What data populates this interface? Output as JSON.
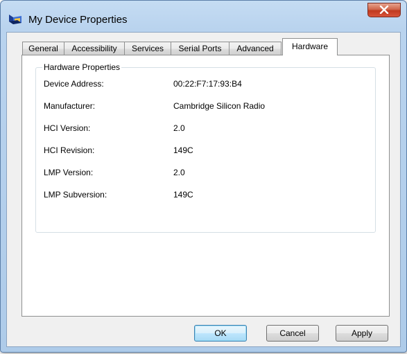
{
  "window": {
    "title": "My Device Properties",
    "app_icon": "bluetooth-device-icon",
    "close_icon": "close-icon",
    "accent_close": "#c0391f"
  },
  "tabs": [
    {
      "label": "General",
      "active": false
    },
    {
      "label": "Accessibility",
      "active": false
    },
    {
      "label": "Services",
      "active": false
    },
    {
      "label": "Serial Ports",
      "active": false
    },
    {
      "label": "Advanced",
      "active": false
    },
    {
      "label": "Hardware",
      "active": true
    }
  ],
  "hardware": {
    "group_title": "Hardware Properties",
    "properties": [
      {
        "label": "Device Address:",
        "value": "00:22:F7:17:93:B4"
      },
      {
        "label": "Manufacturer:",
        "value": "Cambridge Silicon Radio"
      },
      {
        "label": "HCI Version:",
        "value": "2.0"
      },
      {
        "label": "HCI Revision:",
        "value": "149C"
      },
      {
        "label": "LMP Version:",
        "value": "2.0"
      },
      {
        "label": "LMP Subversion:",
        "value": "149C"
      }
    ]
  },
  "buttons": {
    "ok": "OK",
    "cancel": "Cancel",
    "apply": "Apply"
  }
}
